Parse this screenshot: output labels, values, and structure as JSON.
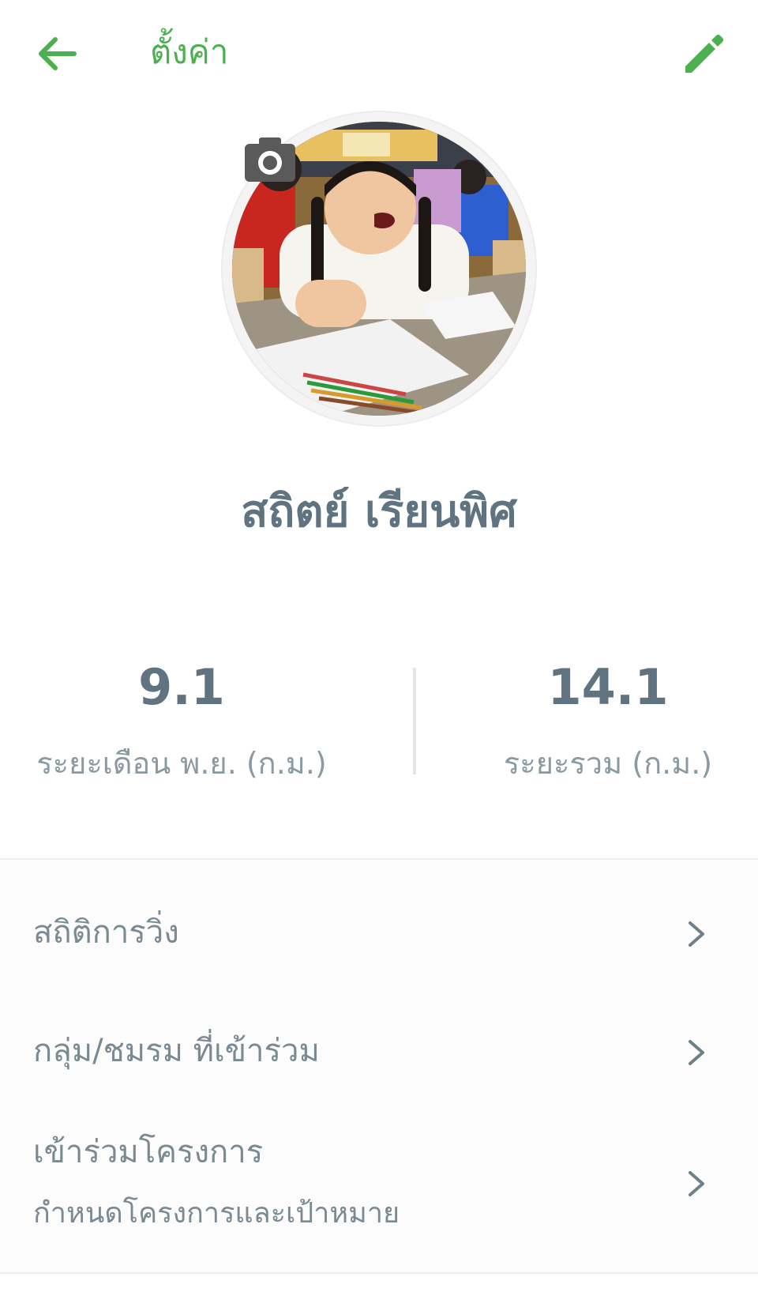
{
  "header": {
    "title": "ตั้งค่า",
    "back_icon": "arrow-left-icon",
    "edit_icon": "pencil-icon"
  },
  "profile": {
    "name": "สถิตย์ เรียนพิศ",
    "avatar_icon": "profile-photo",
    "camera_icon": "camera-icon"
  },
  "stats": {
    "month": {
      "value": "9.1",
      "label": "ระยะเดือน พ.ย. (ก.ม.)"
    },
    "total": {
      "value": "14.1",
      "label": "ระยะรวม (ก.ม.)"
    }
  },
  "menu": {
    "items": [
      {
        "label": "สถิติการวิ่ง",
        "icon": "chevron-right-icon"
      },
      {
        "label": "กลุ่ม/ชมรม ที่เข้าร่วม",
        "icon": "chevron-right-icon"
      },
      {
        "label": "เข้าร่วมโครงการ",
        "sublabel": "กำหนดโครงการและเป้าหมาย",
        "icon": "chevron-right-icon"
      }
    ]
  },
  "colors": {
    "accent": "#4caf50",
    "text_primary": "#5f7480",
    "text_secondary": "#8a9aa3"
  }
}
